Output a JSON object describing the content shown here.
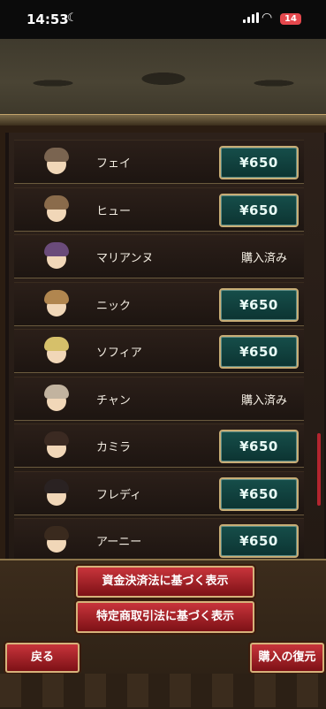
{
  "status_bar": {
    "time": "14:53",
    "battery": "14"
  },
  "characters": [
    {
      "name": "フェイ",
      "price": "¥650",
      "purchased": false,
      "hair": "#7a6450"
    },
    {
      "name": "ヒュー",
      "price": "¥650",
      "purchased": false,
      "hair": "#8a6b4b"
    },
    {
      "name": "マリアンヌ",
      "price": null,
      "purchased": true,
      "status": "購入済み",
      "hair": "#6a4b7a"
    },
    {
      "name": "ニック",
      "price": "¥650",
      "purchased": false,
      "hair": "#b1864f"
    },
    {
      "name": "ソフィア",
      "price": "¥650",
      "purchased": false,
      "hair": "#d6c06a"
    },
    {
      "name": "チャン",
      "price": null,
      "purchased": true,
      "status": "購入済み",
      "hair": "#c2b39f"
    },
    {
      "name": "カミラ",
      "price": "¥650",
      "purchased": false,
      "hair": "#3b2a22"
    },
    {
      "name": "フレディ",
      "price": "¥650",
      "purchased": false,
      "hair": "#2a2222"
    },
    {
      "name": "アーニー",
      "price": "¥650",
      "purchased": false,
      "hair": "#3a2a1e"
    }
  ],
  "buttons": {
    "funds_settlement": "資金決済法に基づく表示",
    "commercial_transactions": "特定商取引法に基づく表示",
    "back": "戻る",
    "restore": "購入の復元"
  },
  "colors": {
    "price_button": "#164e4a",
    "red_button": "#b02329",
    "gold_border": "#c8ad76"
  }
}
